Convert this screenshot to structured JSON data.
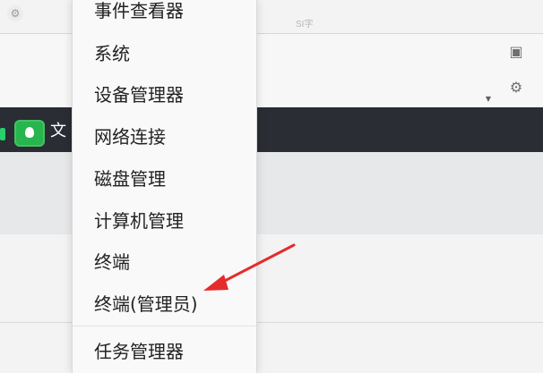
{
  "background": {
    "faint_label": "SI字"
  },
  "menu": {
    "items": [
      {
        "label": "事件查看器"
      },
      {
        "label": "系统"
      },
      {
        "label": "设备管理器"
      },
      {
        "label": "网络连接"
      },
      {
        "label": "磁盘管理"
      },
      {
        "label": "计算机管理"
      },
      {
        "label": "终端"
      },
      {
        "label": "终端(管理员)"
      },
      {
        "label": "任务管理器"
      }
    ]
  },
  "taskbar": {
    "partial_text": "文"
  },
  "annotation": {
    "arrow_color": "#e52b2b"
  }
}
